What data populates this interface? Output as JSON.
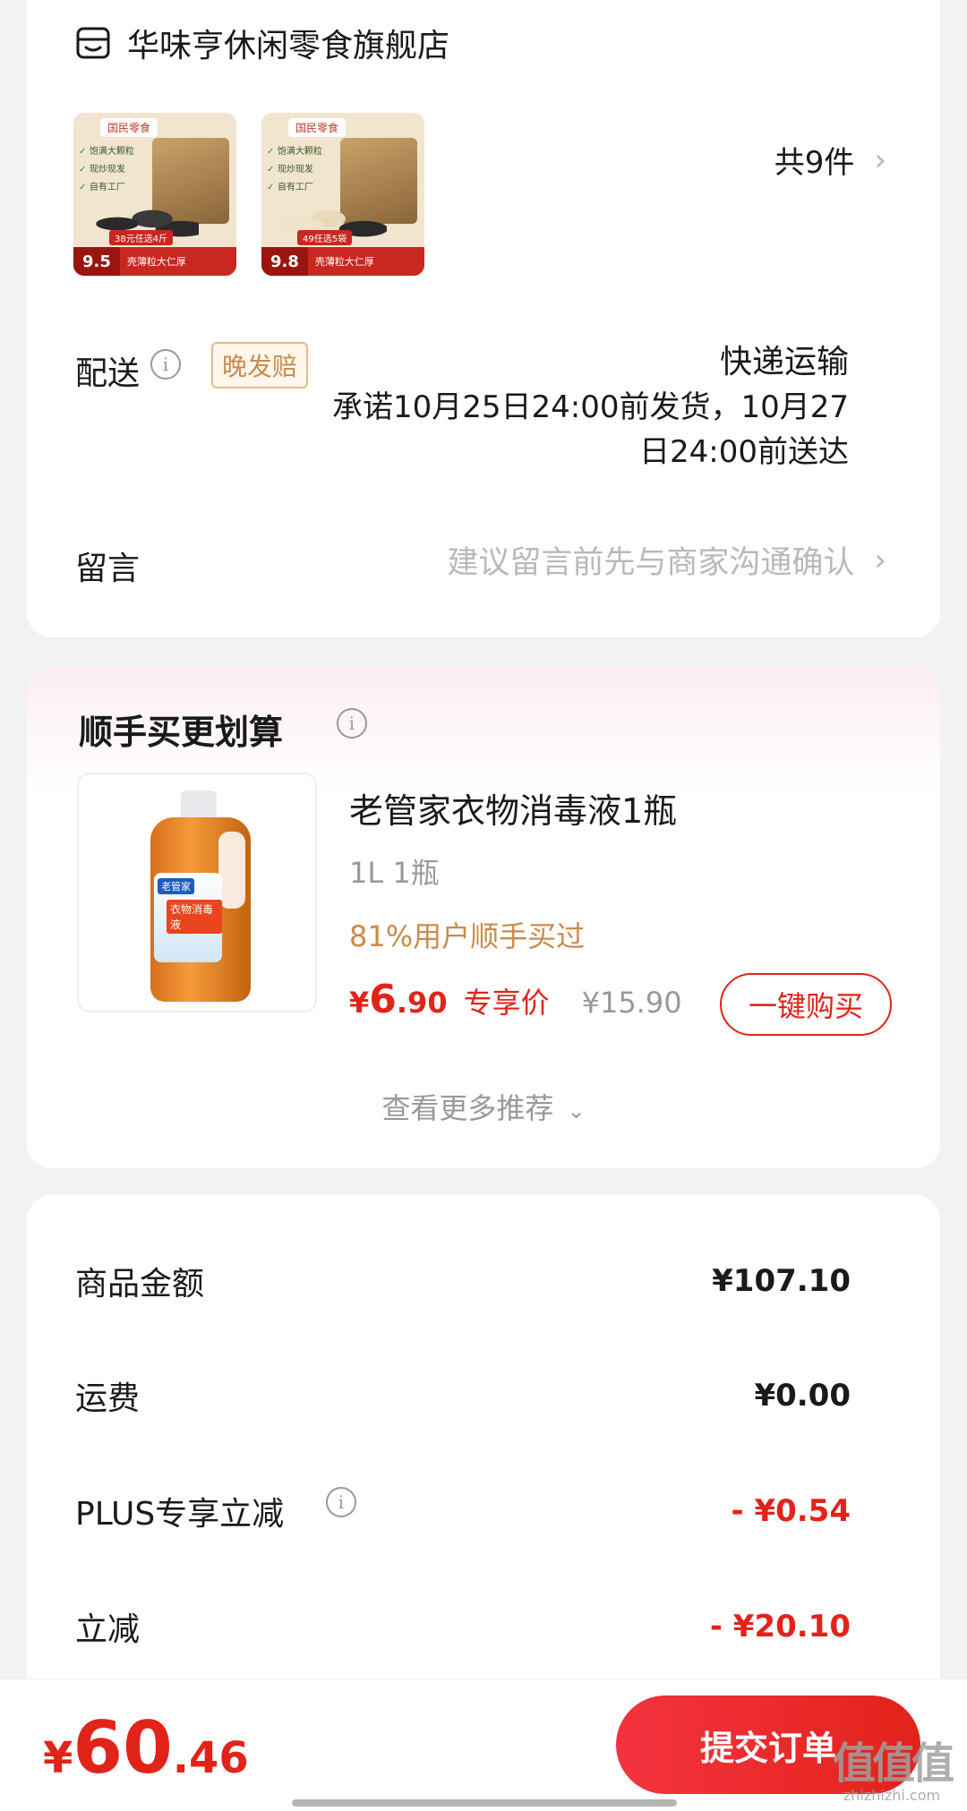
{
  "store": {
    "name": "华味亨休闲零食旗舰店",
    "icon": "store-icon",
    "items": [
      {
        "brand": "国民零食",
        "checks": [
          "饱满大颗粒",
          "现炒现发",
          "自有工厂"
        ],
        "promo": "38元任选4斤",
        "price": "9.5",
        "caption": "壳薄粒大仁厚"
      },
      {
        "brand": "国民零食",
        "checks": [
          "饱满大颗粒",
          "现炒现发",
          "自有工厂"
        ],
        "promo": "49任选5袋",
        "price": "9.8",
        "caption": "壳薄粒大仁厚"
      }
    ],
    "count_label": "共9件",
    "chevron": "›"
  },
  "delivery": {
    "label": "配送",
    "info_icon": "i",
    "badge": "晚发赔",
    "method": "快递运输",
    "promise": "承诺10月25日24:00前发货，10月27日24:00前送达"
  },
  "message": {
    "label": "留言",
    "placeholder": "建议留言前先与商家沟通确认",
    "chevron": "›"
  },
  "bundle": {
    "title": "顺手买更划算",
    "info_icon": "i",
    "product": {
      "name": "老管家衣物消毒液1瓶",
      "spec": "1L 1瓶",
      "social": "81%用户顺手买过",
      "price_symbol": "¥",
      "price_int": "6",
      "price_dec": ".90",
      "price_tag": "专享价",
      "original_price": "¥15.90",
      "buy_label": "一键购买",
      "bottle_brand": "老管家",
      "bottle_type": "衣物消毒液"
    },
    "more_label": "查看更多推荐",
    "more_chevron": "⌄"
  },
  "summary": {
    "rows": [
      {
        "label": "商品金额",
        "value": "¥107.10",
        "color": "#1a1a1a"
      },
      {
        "label": "运费",
        "value": "¥0.00",
        "color": "#1a1a1a"
      },
      {
        "label": "PLUS专享立减",
        "value": "- ¥0.54",
        "color": "#e2231a"
      },
      {
        "label": "立减",
        "value": "- ¥20.10",
        "color": "#e2231a"
      }
    ]
  },
  "footer": {
    "total_symbol": "¥",
    "total_int": "60",
    "total_dec": ".46",
    "submit_label": "提交订单"
  },
  "watermark": {
    "main": "值值值",
    "sub": "zhizhizhi.com"
  },
  "colors": {
    "accent": "#e2231a",
    "muted": "#999999",
    "social": "#c98b4a"
  }
}
